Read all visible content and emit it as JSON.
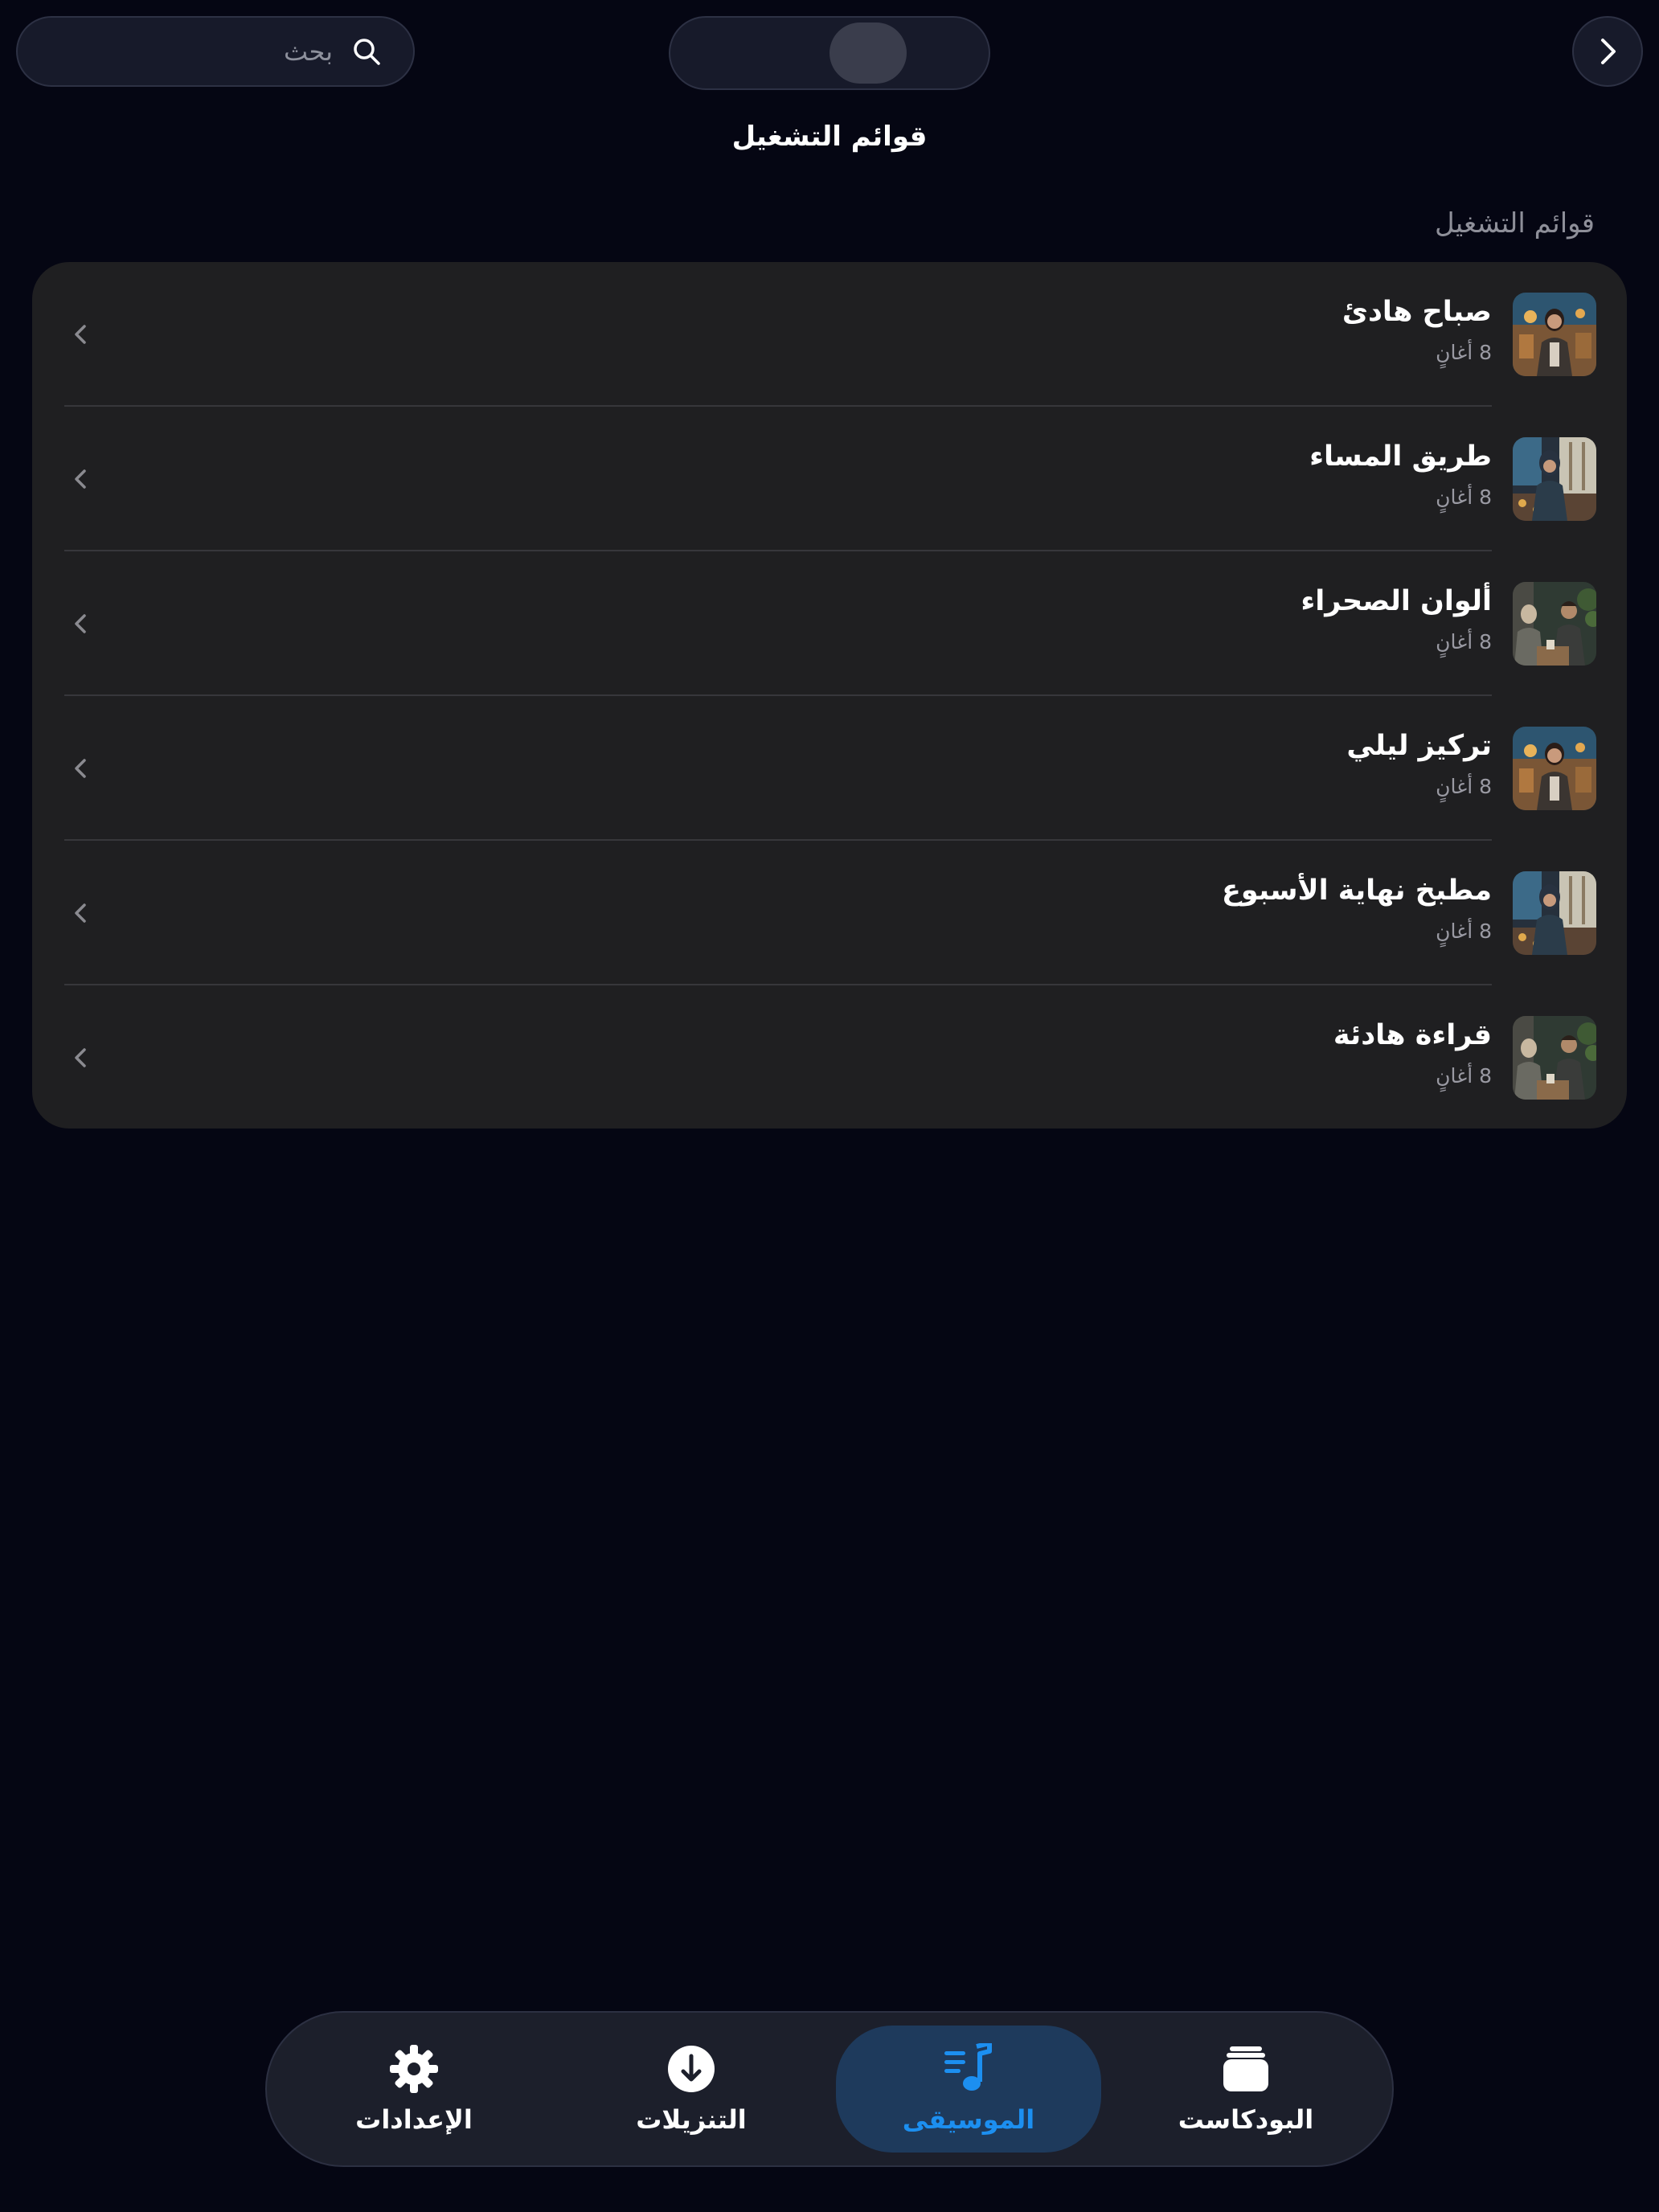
{
  "header": {
    "search_placeholder": "بحث",
    "title": "قوائم التشغيل"
  },
  "section": {
    "title": "قوائم التشغيل"
  },
  "playlists": [
    {
      "title": "صباح هادئ",
      "subtitle": "8 أغانٍ"
    },
    {
      "title": "طريق المساء",
      "subtitle": "8 أغانٍ"
    },
    {
      "title": "ألوان الصحراء",
      "subtitle": "8 أغانٍ"
    },
    {
      "title": "تركيز ليلي",
      "subtitle": "8 أغانٍ"
    },
    {
      "title": "مطبخ نهاية الأسبوع",
      "subtitle": "8 أغانٍ"
    },
    {
      "title": "قراءة هادئة",
      "subtitle": "8 أغانٍ"
    }
  ],
  "tabs": [
    {
      "label": "البودكاست",
      "icon": "podcast-stack-icon"
    },
    {
      "label": "الموسيقى",
      "icon": "music-note-icon",
      "active": true
    },
    {
      "label": "التنزيلات",
      "icon": "download-icon"
    },
    {
      "label": "الإعدادات",
      "icon": "gear-icon"
    }
  ],
  "colors": {
    "background": "#050613",
    "card": "#1f1f21",
    "accent": "#1c8ff0",
    "active_tab": "#1e3a5c"
  }
}
